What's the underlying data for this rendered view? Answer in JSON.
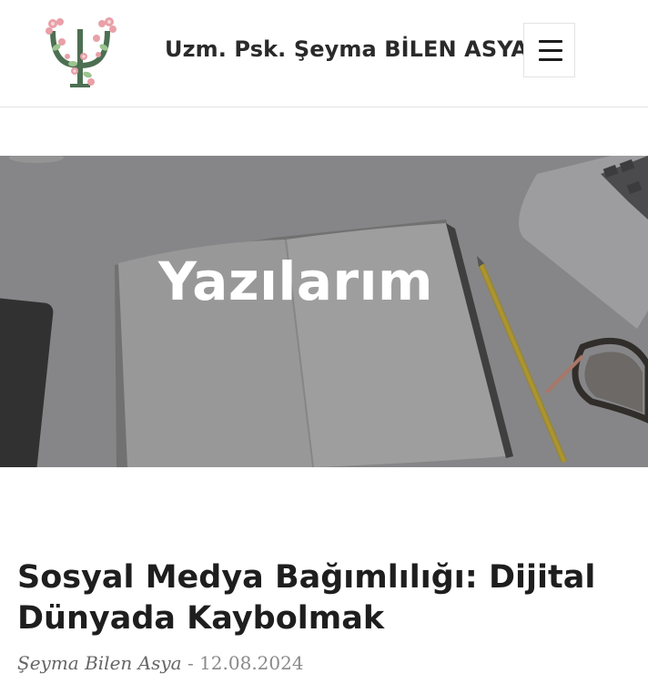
{
  "header": {
    "site_title": "Uzm. Psk. Şeyma BİLEN ASYA",
    "logo_icon": "psi-flower-logo-icon",
    "menu_icon": "hamburger-menu-icon"
  },
  "hero": {
    "title": "Yazılarım"
  },
  "post": {
    "title": "Sosyal Medya Bağımlılığı: Dijital Dünyada Kaybolmak",
    "author": "Şeyma Bilen Asya",
    "separator": "-",
    "date": "12.08.2024"
  },
  "colors": {
    "logo_green": "#4c6f52",
    "logo_pink": "#e9a0a8",
    "logo_leaf": "#9cc48f",
    "hero_overlay": "#555555",
    "pencil_yellow": "#d9b52a"
  }
}
